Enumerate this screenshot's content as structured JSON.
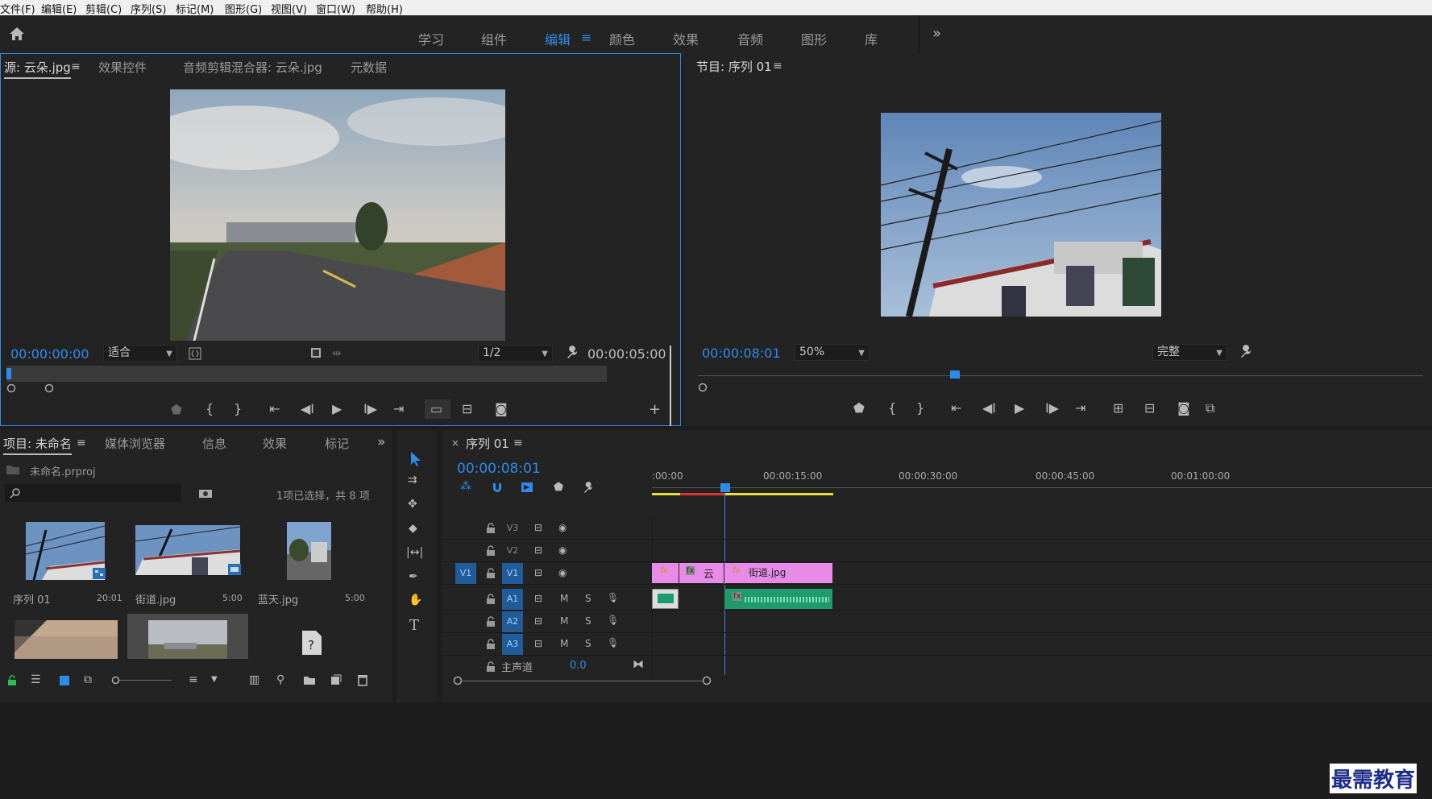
{
  "menu": {
    "items": [
      "文件(F)",
      "编辑(E)",
      "剪辑(C)",
      "序列(S)",
      "标记(M)",
      "图形(G)",
      "视图(V)",
      "窗口(W)",
      "帮助(H)"
    ]
  },
  "workspaces": {
    "tabs": [
      "学习",
      "组件",
      "编辑",
      "颜色",
      "效果",
      "音频",
      "图形",
      "库"
    ],
    "active": "编辑",
    "overflow_icon": "double-chevron-right"
  },
  "source_panel": {
    "tabs": [
      "源: 云朵.jpg",
      "效果控件",
      "音频剪辑混合器: 云朵.jpg",
      "元数据"
    ],
    "timecode_in": "00:00:00:00",
    "fit_select": "适合",
    "resolution_select": "1/2",
    "duration": "00:00:05:00"
  },
  "program_panel": {
    "title": "节目: 序列 01",
    "timecode": "00:00:08:01",
    "zoom_select": "50%",
    "quality_select": "完整"
  },
  "project_panel": {
    "tabs": [
      "项目: 未命名",
      "媒体浏览器",
      "信息",
      "效果",
      "标记"
    ],
    "project_file": "未命名.prproj",
    "selection_status": "1项已选择，共 8 项",
    "items": [
      {
        "name": "序列 01",
        "duration": "20:01"
      },
      {
        "name": "街道.jpg",
        "duration": "5:00"
      },
      {
        "name": "蓝天.jpg",
        "duration": "5:00"
      },
      {
        "name": "",
        "duration": ""
      },
      {
        "name": "",
        "duration": ""
      },
      {
        "name": "",
        "duration": ""
      }
    ]
  },
  "timeline": {
    "tab": "序列 01",
    "timecode": "00:00:08:01",
    "ruler_labels": [
      ":00:00",
      "00:00:15:00",
      "00:00:30:00",
      "00:00:45:00",
      "00:01:00:00"
    ],
    "tracks_video": [
      "V3",
      "V2",
      "V1"
    ],
    "tracks_audio": [
      "A1",
      "A2",
      "A3"
    ],
    "source_patch_v": "V1",
    "source_patch_a": [
      "A1",
      "A2",
      "A3"
    ],
    "master_label": "主声道",
    "master_value": "0.0",
    "mute_label": "M",
    "solo_label": "S",
    "clips": {
      "v1_clip2_label": "云",
      "v1_clip3_label": "街道.jpg",
      "fx": "fx"
    }
  },
  "watermark": "最需教育",
  "colors": {
    "accent": "#2d8ceb",
    "clip_video": "#e88be8",
    "clip_audio": "#1f9a6f",
    "patch_blue": "#1f5c99",
    "ruler_yellow": "#e8e03a",
    "ruler_red": "#d33"
  }
}
